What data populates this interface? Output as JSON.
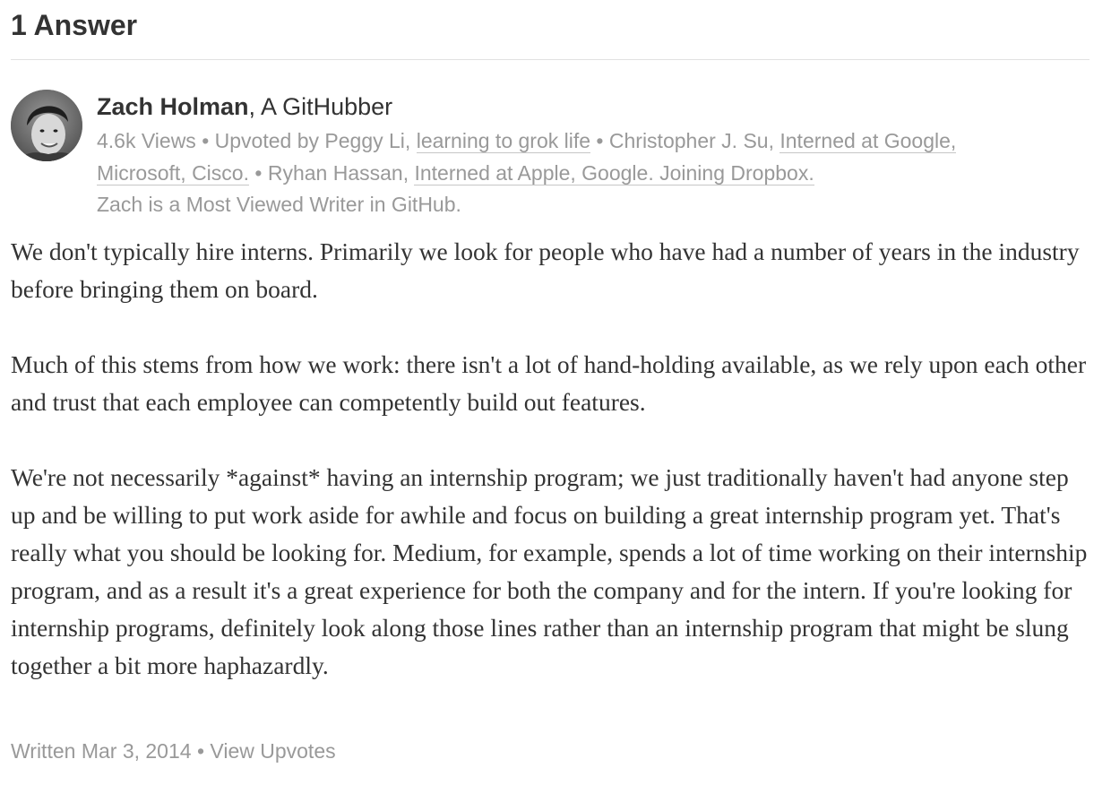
{
  "header": {
    "answer_count": "1 Answer"
  },
  "author": {
    "name": "Zach Holman",
    "credential": ", A GitHubber",
    "avatar_icon": "person-avatar"
  },
  "meta": {
    "views": "4.6k Views",
    "sep": " • ",
    "upvoted_by_prefix": "Upvoted by ",
    "upvoters": [
      {
        "name": "Peggy Li",
        "credential": "learning to grok life"
      },
      {
        "name": "Christopher J. Su",
        "credential_line1": "Interned at Google,",
        "credential_line2": "Microsoft, Cisco."
      },
      {
        "name": "Ryhan Hassan",
        "credential": "Interned at Apple, Google. Joining Dropbox."
      }
    ],
    "writer_note": "Zach is a Most Viewed Writer in GitHub."
  },
  "body": {
    "paragraphs": [
      "We don't typically hire interns. Primarily we look for people who have had a number of years in the industry before bringing them on board.",
      "Much of this stems from how we work: there isn't a lot of hand-holding available, as we rely upon each other and trust that each employee can competently build out features.",
      "We're not necessarily *against* having an internship program; we just traditionally haven't had anyone step up and be willing to put work aside for awhile and focus on building a great internship program yet. That's really what you should be looking for. Medium, for example, spends a lot of time working on their internship program, and as a result it's a great experience for both the company and for the intern. If you're looking for internship programs, definitely look along those lines rather than an internship program that might be slung together a bit more haphazardly."
    ]
  },
  "footer": {
    "written": "Written Mar 3, 2014",
    "sep": " • ",
    "view_upvotes": "View Upvotes"
  }
}
